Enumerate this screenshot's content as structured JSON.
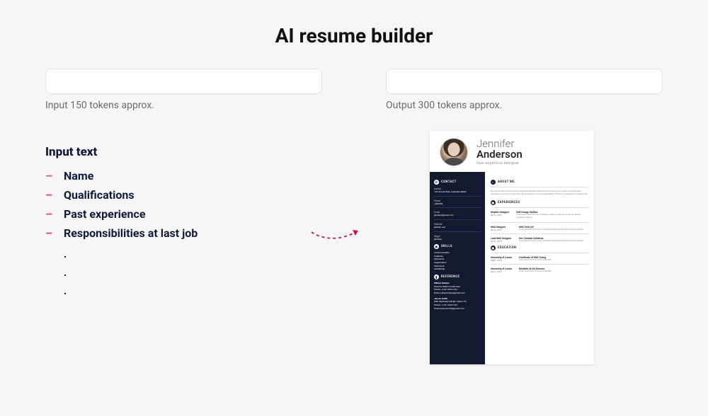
{
  "title": "AI resume builder",
  "input_caption": "Input 150 tokens approx.",
  "output_caption": "Output 300 tokens approx.",
  "input_heading": "Input text",
  "bullets": [
    "Name",
    "Qualifications",
    "Past experience",
    "Responsibilities at last job"
  ],
  "sub_dots": [
    ".",
    ".",
    "."
  ],
  "resume": {
    "first_name": "Jennifer",
    "last_name": "Anderson",
    "role": "User experince designer",
    "sidebar": {
      "contact_title": "CONTACT",
      "address_label": "Adress",
      "address": "129 Avocia Stret, Australia 46000",
      "phone_label": "Phone",
      "phone": "+000000",
      "email_label": "Email",
      "email": "jenston@gmail.com",
      "website_label": "Website",
      "website": "jenston.con",
      "skype_label": "Skype",
      "skype": "jamhers",
      "skills_title": "SKILLS",
      "skills": [
        "Communication",
        "Creativity",
        "Teamwork",
        "Organization",
        "Teamwork",
        "Leadership"
      ],
      "reference_title": "REFERENCE",
      "ref1_name": "William Keisten",
      "ref1_role": "Director, Matrix media ined",
      "ref1_phone": "Phone: +123-1234-1234",
      "ref1_email": "Email williamkchen@gmail.com",
      "ref2_name": "Janson Smith",
      "ref2_role": "Web developer, Design match, TD",
      "ref2_phone": "Phone: +123-1234-1234",
      "ref2_email": "Email jansonsmith@gmail.com"
    },
    "about": {
      "title": "ABOUT ME",
      "body": "My name is Glenn Phillip Crampon. Distinguish between statement that is simply good. It gives people the great advantage to see work in many ways. Being a designer I have big responsibility to make sure everything is working well."
    },
    "experiences": {
      "title": "EXPERIENCES",
      "items": [
        {
          "role": "Graphic Designer",
          "dates": "2012 - 2011",
          "place": "Soft Design Studios"
        },
        {
          "role": "Web Designer",
          "dates": "2013 - 2012",
          "place": "Web Tech Ltd"
        },
        {
          "role": "Lead Web Designer",
          "dates": "2010 - 2013",
          "place": "Dev Creative Solutions"
        }
      ]
    },
    "education": {
      "title": "EDUCATION",
      "items": [
        {
          "uni": "University of Lorem",
          "dates": "2008 - 2010",
          "degree": "Certificate of Web Traing"
        },
        {
          "uni": "University of Lorem",
          "dates": "2013 - 2017",
          "degree": "Bachelor of Art Director"
        }
      ]
    }
  }
}
